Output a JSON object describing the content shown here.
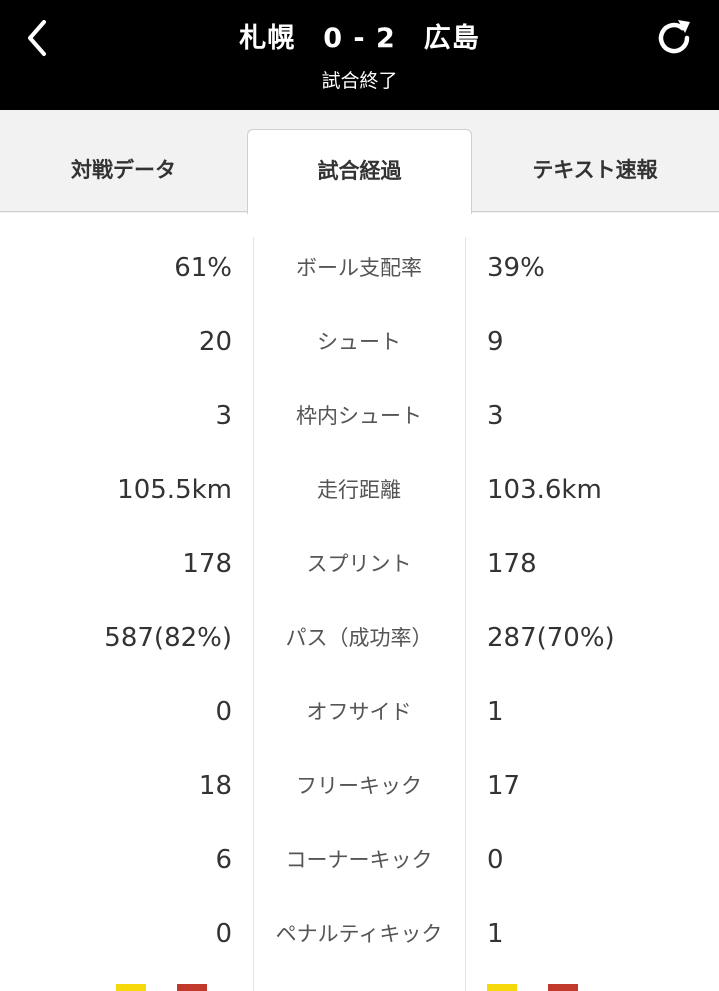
{
  "header": {
    "title": "札幌　0 - 2　広島",
    "status": "試合終了",
    "back_icon": "chevron-left-icon",
    "refresh_icon": "refresh-icon"
  },
  "tabs": [
    {
      "label": "対戦データ",
      "active": false
    },
    {
      "label": "試合経過",
      "active": true
    },
    {
      "label": "テキスト速報",
      "active": false
    }
  ],
  "stats": [
    {
      "label": "ボール支配率",
      "home": "61%",
      "away": "39%"
    },
    {
      "label": "シュート",
      "home": "20",
      "away": "9"
    },
    {
      "label": "枠内シュート",
      "home": "3",
      "away": "3"
    },
    {
      "label": "走行距離",
      "home": "105.5km",
      "away": "103.6km"
    },
    {
      "label": "スプリント",
      "home": "178",
      "away": "178"
    },
    {
      "label": "パス（成功率）",
      "home": "587(82%)",
      "away": "287(70%)"
    },
    {
      "label": "オフサイド",
      "home": "0",
      "away": "1"
    },
    {
      "label": "フリーキック",
      "home": "18",
      "away": "17"
    },
    {
      "label": "コーナーキック",
      "home": "6",
      "away": "0"
    },
    {
      "label": "ペナルティキック",
      "home": "0",
      "away": "1"
    }
  ],
  "colors": {
    "header_bg": "#000000",
    "tabbar_bg": "#f2f2f2",
    "yellow_card": "#f5d90a",
    "red_card": "#c0392b"
  }
}
